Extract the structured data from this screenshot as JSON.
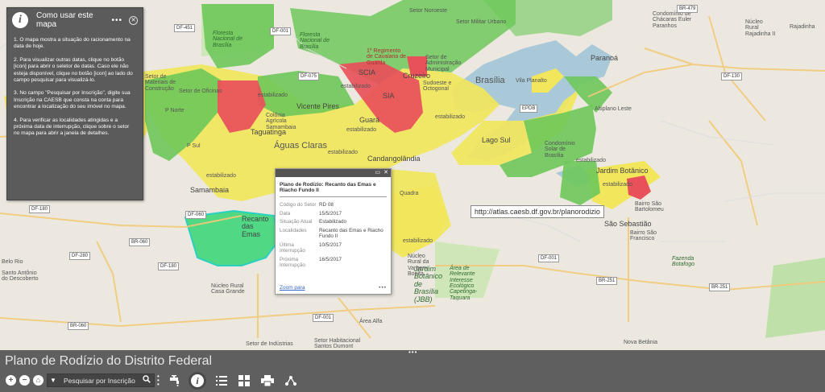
{
  "app": {
    "title": "Plano de Rodízio do Distrito Federal"
  },
  "info_panel": {
    "title": "Como usar este mapa",
    "more": "•••",
    "close": "✕",
    "steps": [
      "1. O mapa mostra a situação do racionamento na data de hoje.",
      "2. Para visualizar outras datas, clique no botão [icon] para abrir o seletor de datas. Caso ele não esteja disponível, clique no botão [icon] ao lado do campo pesquisar para visualizá-lo.",
      "3. No campo \"Pesquisar por Inscrição\", digite sua Inscrição na CAESB que consta na conta para encontrar a localização do seu imóvel no mapa.",
      "4. Para verificar as localidades atingidas e a próxima data de interrupção, clique sobre o setor no mapa para abrir a janela de detalhes."
    ]
  },
  "popup": {
    "title": "Plano de Rodízio: Recanto das Emas e Riacho Fundo II",
    "fields": [
      {
        "key": "Código do Setor",
        "value": "RD 08"
      },
      {
        "key": "Data",
        "value": "15/5/2017"
      },
      {
        "key": "Situação Atual",
        "value": "Estabilizado"
      },
      {
        "key": "Localidades",
        "value": "Recanto das Emas e Riacho Fundo II"
      },
      {
        "key": "Última Interrupção",
        "value": "10/5/2017"
      },
      {
        "key": "Próxima Interrupção",
        "value": "16/5/2017"
      }
    ],
    "zoom_label": "Zoom para",
    "more": "•••",
    "maximize": "▭",
    "close": "✕"
  },
  "url_tooltip": "http://atlas.caesb.df.gov.br/planorodizio",
  "search": {
    "placeholder": "Pesquisar por Inscrição"
  },
  "toolbar": {
    "zoom_in": "+",
    "zoom_out": "−",
    "home": "⌂",
    "search_icon": "🔍",
    "handle": "•••"
  },
  "map_labels": {
    "setor_noroeste": "Setor Noroeste",
    "setor_militar": "Setor Militar Urbano",
    "floresta_nacional": "Floresta Nacional de Brasília",
    "floresta_nacional2": "Floresta Nacional de Brasília",
    "regimento": "1º Regimento de Cavalaria de Guarda",
    "administracao": "Setor de Administração Municipal",
    "scia": "SCIA",
    "cruzeiro": "Cruzeiro",
    "sia": "SIA",
    "sudoeste": "Sudoeste e Octogonal",
    "brasilia": "Brasília",
    "vila_planalto": "Vila Planalto",
    "paranoa": "Paranoá",
    "condominio": "Condomínio de Chácaras Euler Paranhos",
    "nucleo_rural": "Núcleo Rural Rajadinha II",
    "rajadinha": "Rajadinha",
    "setor_materiais": "Setor de Materiais de Construção",
    "setor_oficinas": "Setor de Oficinas",
    "p_norte": "P Norte",
    "vicente_pires": "Vicente Pires",
    "colonia_agricola": "Colônia Agrícola Samambaia",
    "guara": "Guará",
    "taguatinga": "Taguatinga",
    "aguas_claras": "Águas Claras",
    "candangolandia": "Candangolândia",
    "lago_sul": "Lago Sul",
    "altiplano_leste": "Altiplano Leste",
    "condominio_solar": "Condomínio Solar de Brasília",
    "jardim_botanico": "Jardim Botânico",
    "p_sul": "P Sul",
    "samambaia": "Samambaia",
    "recanto": "Recanto das Emas",
    "sao_sebastiao": "São Sebastião",
    "bairro_sao_bartolomeu": "Bairro São Bartolomeu",
    "bairro_sao_francisco": "Bairro São Francisco",
    "quadra": "Quadra",
    "jardim_botanico_bsb": "Jardim Botânico de Brasília (JBB)",
    "area_relevante": "Área de Relevante Interesse Ecológico Capetinga-Taquara",
    "nucleo_rural_casa": "Núcleo Rural Casa Grande",
    "area_alfa": "Área Alfa",
    "santos_dumont": "Setor Habitacional Santos Dumont",
    "setor_industrias": "Setor de Indústrias",
    "nova_betania": "Nova Betânia",
    "santo_antonio": "Santo Antônio do Descoberto",
    "belo_rio": "Belo Rio",
    "fazenda_botafogo": "Fazenda Botafogo",
    "nucleo_rural_vargem": "Núcleo Rural da Vargem Bonita",
    "estabilizado": "estabilizado"
  }
}
